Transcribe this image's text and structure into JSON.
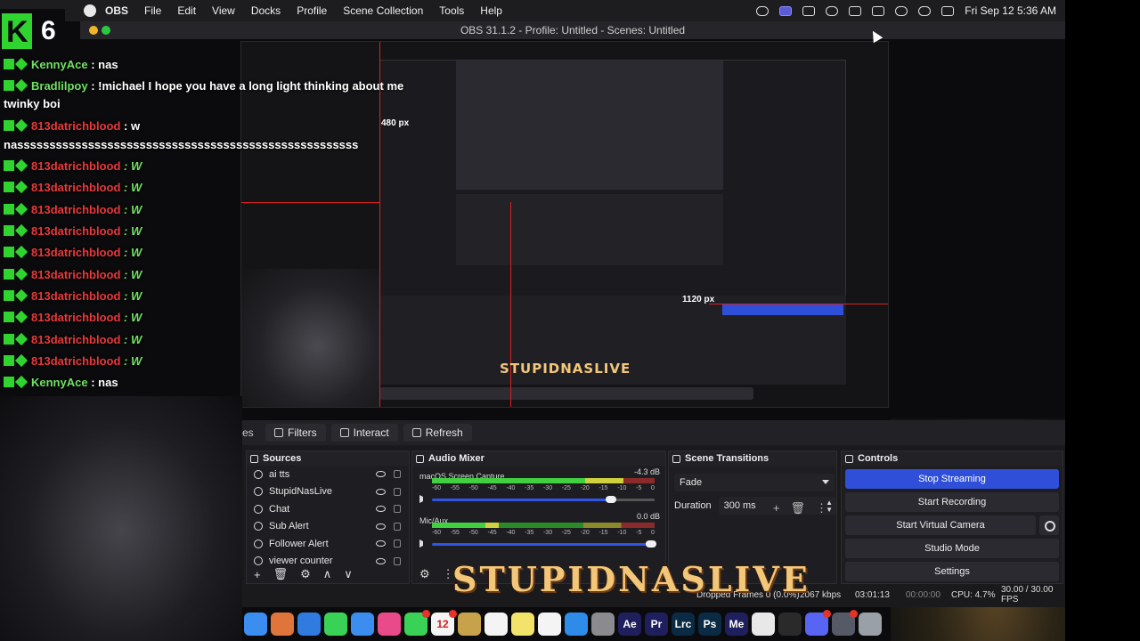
{
  "menubar": {
    "app": "OBS",
    "items": [
      "File",
      "Edit",
      "View",
      "Docks",
      "Profile",
      "Scene Collection",
      "Tools",
      "Help"
    ],
    "clock": "Fri Sep 12  5:36 AM"
  },
  "window": {
    "title": "OBS 31.1.2 - Profile: Untitled - Scenes: Untitled"
  },
  "chat": {
    "viewer_count": "6",
    "lines": [
      {
        "user": "KennyAce",
        "text": ": nas",
        "color": "green"
      },
      {
        "user": "Bradlilpoy",
        "text": ": !michael I hope you have a long light thinking about me",
        "color": "green"
      },
      {
        "user": "",
        "text": "twinky boi",
        "color": "white"
      },
      {
        "user": "813datrichblood",
        "text": ": w",
        "color": "red"
      },
      {
        "user": "",
        "text": "nasssssssssssssssssssssssssssssssssssssssssssssssssssss",
        "color": "white"
      },
      {
        "user": "813datrichblood",
        "text": ": W",
        "color": "red"
      },
      {
        "user": "813datrichblood",
        "text": ": W",
        "color": "red"
      },
      {
        "user": "813datrichblood",
        "text": ": W",
        "color": "red"
      },
      {
        "user": "813datrichblood",
        "text": ": W",
        "color": "red"
      },
      {
        "user": "813datrichblood",
        "text": ": W",
        "color": "red"
      },
      {
        "user": "813datrichblood",
        "text": ": W",
        "color": "red"
      },
      {
        "user": "813datrichblood",
        "text": ": W",
        "color": "red"
      },
      {
        "user": "813datrichblood",
        "text": ": W",
        "color": "red"
      },
      {
        "user": "813datrichblood",
        "text": ": W",
        "color": "red"
      },
      {
        "user": "813datrichblood",
        "text": ": W",
        "color": "red"
      },
      {
        "user": "KennyAce",
        "text": ": nas",
        "color": "green"
      }
    ]
  },
  "preview": {
    "label_1120": "1120 px",
    "label_480": "480 px",
    "brand": "STUPIDNASLIVE"
  },
  "toolbar": {
    "scenes_label": "es",
    "filters": "Filters",
    "interact": "Interact",
    "refresh": "Refresh"
  },
  "sources": {
    "title": "Sources",
    "items": [
      "ai tts",
      "StupidNasLive",
      "Chat",
      "Sub Alert",
      "Follower Alert",
      "viewer counter"
    ]
  },
  "mixer": {
    "title": "Audio Mixer",
    "channels": [
      {
        "name": "macOS Screen Capture",
        "db": "-4.3 dB",
        "level": 0.86,
        "volume": 0.82
      },
      {
        "name": "Mic/Aux",
        "db": "0.0 dB",
        "level": 0.3,
        "volume": 1.0
      }
    ],
    "scale": [
      "-60",
      "-55",
      "-50",
      "-45",
      "-40",
      "-35",
      "-30",
      "-25",
      "-20",
      "-15",
      "-10",
      "-5",
      "0"
    ]
  },
  "transitions": {
    "title": "Scene Transitions",
    "type": "Fade",
    "duration_label": "Duration",
    "duration": "300 ms"
  },
  "controls": {
    "title": "Controls",
    "stop_streaming": "Stop Streaming",
    "start_recording": "Start Recording",
    "start_virtual_camera": "Start Virtual Camera",
    "studio_mode": "Studio Mode",
    "settings": "Settings"
  },
  "status": {
    "dropped": "Dropped Frames 0 (0.0%)",
    "kbps": "2067 kbps",
    "stream_time": "03:01:13",
    "rec_time": "00:00:00",
    "cpu": "CPU: 4.7%",
    "fps": "30.00 / 30.00 FPS"
  },
  "brand_banner": "STUPIDNASLIVE",
  "dock_apps": [
    {
      "name": "finder",
      "color": "#3b8df0",
      "label": ""
    },
    {
      "name": "launchpad",
      "color": "#e0753b",
      "label": ""
    },
    {
      "name": "safari",
      "color": "#2f7be0",
      "label": ""
    },
    {
      "name": "messages",
      "color": "#3ad256",
      "label": ""
    },
    {
      "name": "mail",
      "color": "#3b8df0",
      "label": ""
    },
    {
      "name": "photos",
      "color": "#e94a8a",
      "label": ""
    },
    {
      "name": "facetime",
      "color": "#3ad256",
      "label": ""
    },
    {
      "name": "calendar",
      "color": "#f4f4f4",
      "label": "12"
    },
    {
      "name": "notes-app",
      "color": "#c8a24a",
      "label": ""
    },
    {
      "name": "reminders",
      "color": "#f4f4f4",
      "label": ""
    },
    {
      "name": "notes",
      "color": "#f4e36a",
      "label": ""
    },
    {
      "name": "freeform",
      "color": "#f4f4f4",
      "label": ""
    },
    {
      "name": "app-store",
      "color": "#2f8be8",
      "label": ""
    },
    {
      "name": "system-settings",
      "color": "#8a8a8f",
      "label": ""
    },
    {
      "name": "after-effects",
      "color": "#1f1f5e",
      "label": "Ae"
    },
    {
      "name": "premiere",
      "color": "#1f1f5e",
      "label": "Pr"
    },
    {
      "name": "lightroom-classic",
      "color": "#0b2a44",
      "label": "Lrc"
    },
    {
      "name": "photoshop",
      "color": "#0b2a44",
      "label": "Ps"
    },
    {
      "name": "media-encoder",
      "color": "#1f1f5e",
      "label": "Me"
    },
    {
      "name": "chrome",
      "color": "#e8e8e8",
      "label": ""
    },
    {
      "name": "obs",
      "color": "#2a2a2a",
      "label": ""
    },
    {
      "name": "discord",
      "color": "#5865f2",
      "label": ""
    },
    {
      "name": "screen-capture",
      "color": "#555a66",
      "label": ""
    },
    {
      "name": "trash",
      "color": "#9aa0a8",
      "label": ""
    }
  ]
}
